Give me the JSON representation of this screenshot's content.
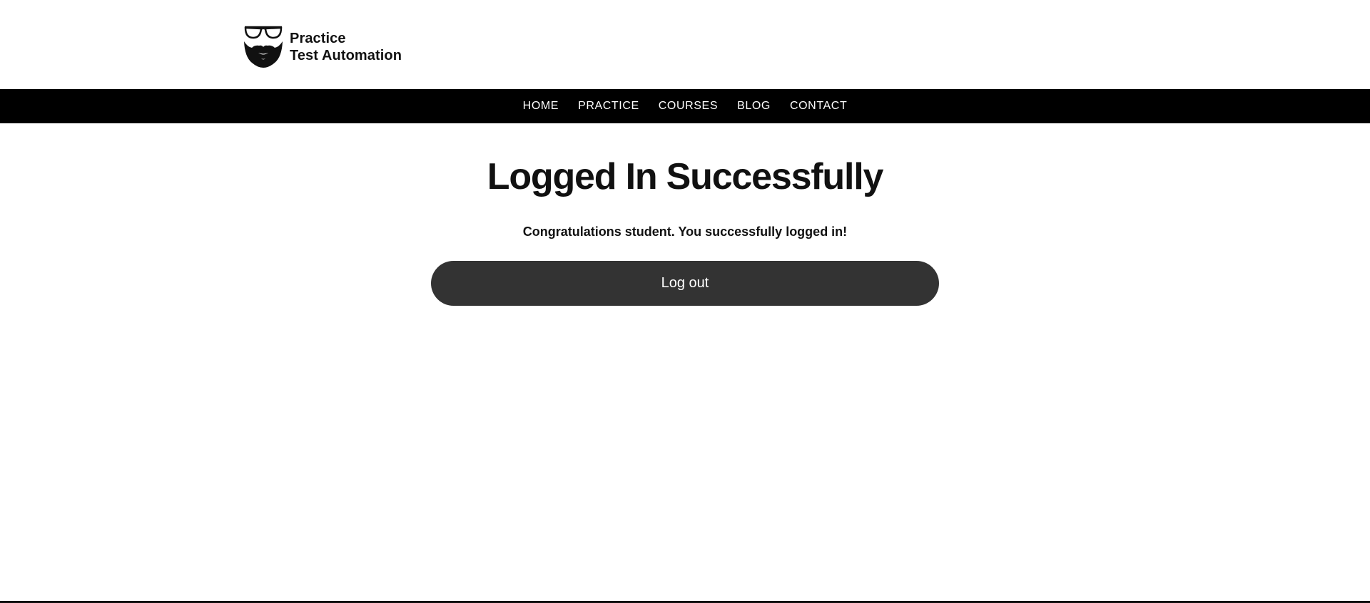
{
  "header": {
    "logo": {
      "line1": "Practice",
      "line2": "Test Automation",
      "icon": "glasses-beard-icon"
    }
  },
  "nav": {
    "items": [
      {
        "label": "HOME"
      },
      {
        "label": "PRACTICE"
      },
      {
        "label": "COURSES"
      },
      {
        "label": "BLOG"
      },
      {
        "label": "CONTACT"
      }
    ]
  },
  "main": {
    "title": "Logged In Successfully",
    "message": "Congratulations student. You successfully logged in!",
    "logout_label": "Log out"
  },
  "colors": {
    "nav_background": "#000000",
    "button_background": "#333333",
    "text": "#111111"
  }
}
